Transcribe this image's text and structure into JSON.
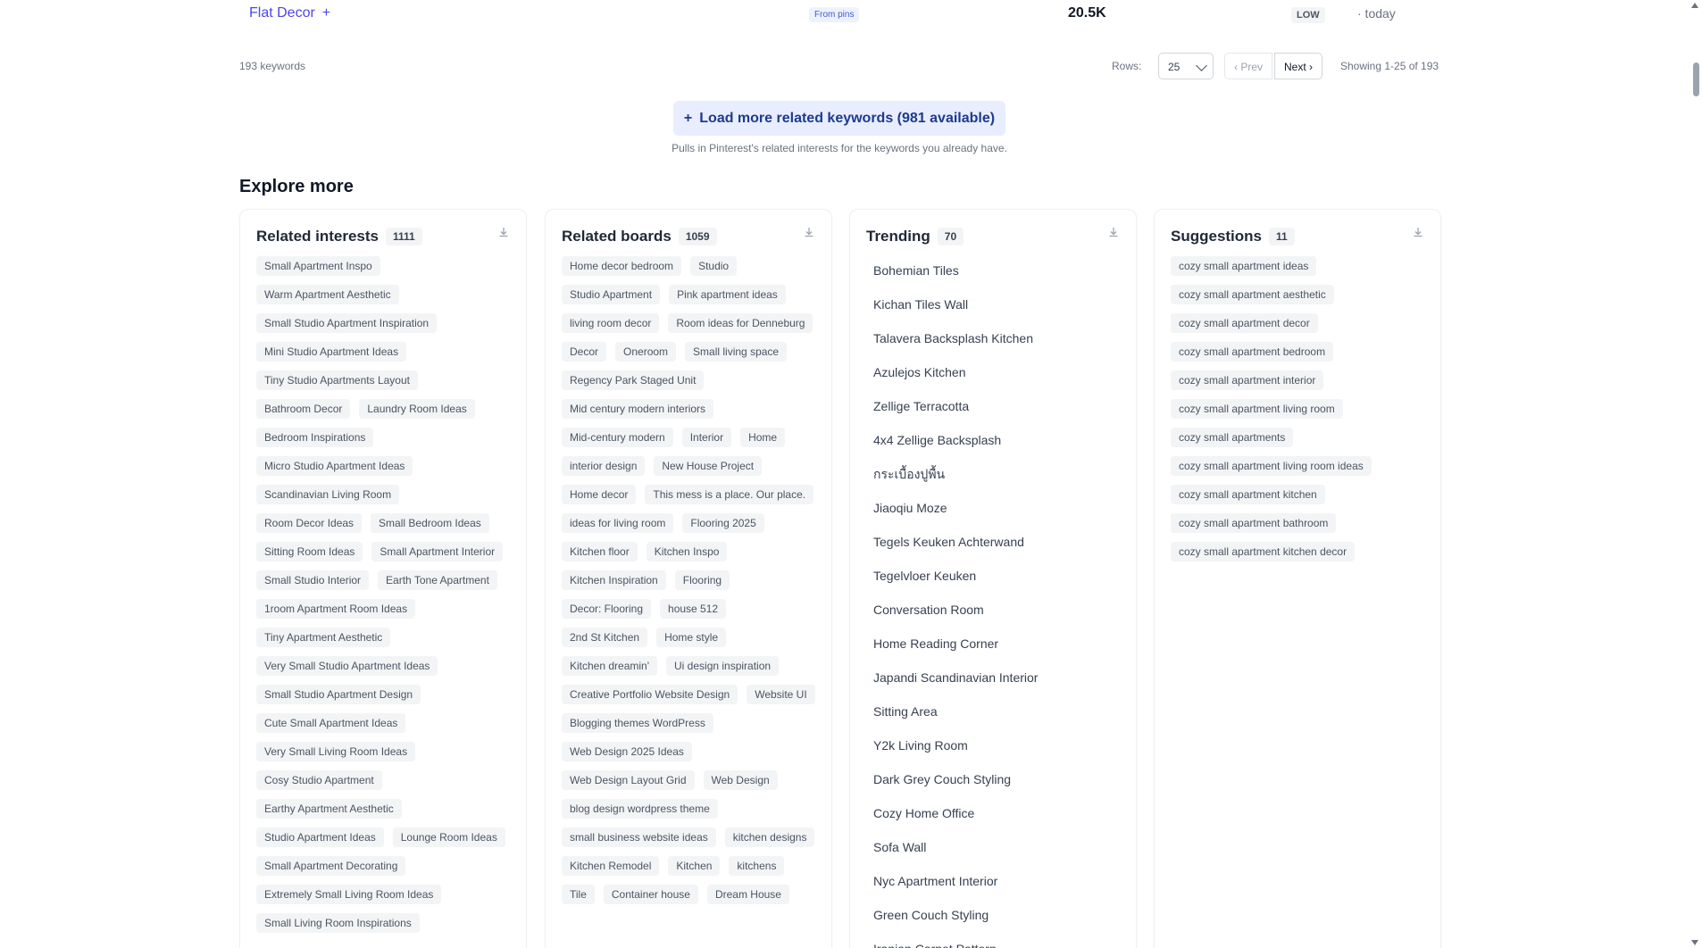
{
  "keyword_row": {
    "name": "Flat Decor",
    "add_label": "+",
    "source_badge": "From pins",
    "volume": "20.5K",
    "competition": "LOW",
    "date": "· today"
  },
  "pagination": {
    "count": "193 keywords",
    "rows_label": "Rows:",
    "rows_value": "25",
    "prev": "‹ Prev",
    "next": "Next ›",
    "showing": "Showing 1-25 of 193"
  },
  "load_more": {
    "label": "Load more related keywords (981 available)",
    "icon": "plus-icon",
    "note": "Pulls in Pinterest's related interests for the keywords you already have."
  },
  "explore": {
    "title": "Explore more",
    "related_interests": {
      "title": "Related interests",
      "count": "1111",
      "items": [
        "Small Apartment Inspo",
        "Warm Apartment Aesthetic",
        "Small Studio Apartment Inspiration",
        "Mini Studio Apartment Ideas",
        "Tiny Studio Apartments Layout",
        "Bathroom Decor",
        "Laundry Room Ideas",
        "Bedroom Inspirations",
        "Micro Studio Apartment Ideas",
        "Scandinavian Living Room",
        "Room Decor Ideas",
        "Small Bedroom Ideas",
        "Sitting Room Ideas",
        "Small Apartment Interior",
        "Small Studio Interior",
        "Earth Tone Apartment",
        "1room Apartment Room Ideas",
        "Tiny Apartment Aesthetic",
        "Very Small Studio Apartment Ideas",
        "Small Studio Apartment Design",
        "Cute Small Apartment Ideas",
        "Very Small Living Room Ideas",
        "Cosy Studio Apartment",
        "Earthy Apartment Aesthetic",
        "Studio Apartment Ideas",
        "Lounge Room Ideas",
        "Small Apartment Decorating",
        "Extremely Small Living Room Ideas",
        "Small Living Room Inspirations"
      ]
    },
    "related_boards": {
      "title": "Related boards",
      "count": "1059",
      "items": [
        "Home decor bedroom",
        "Studio",
        "Studio Apartment",
        "Pink apartment ideas",
        "living room decor",
        "Room ideas for Denneburg",
        "Decor",
        "Oneroom",
        "Small living space",
        "Regency Park Staged Unit",
        "Mid century modern interiors",
        "Mid-century modern",
        "Interior",
        "Home",
        "interior design",
        "New House Project",
        "Home decor",
        "This mess is a place. Our place.",
        "ideas for living room",
        "Flooring 2025",
        "Kitchen floor",
        "Kitchen Inspo",
        "Kitchen Inspiration",
        "Flooring",
        "Decor: Flooring",
        "house 512",
        "2nd St Kitchen",
        "Home style",
        "Kitchen dreamin'",
        "Ui design inspiration",
        "Creative Portfolio Website Design",
        "Website UI",
        "Blogging themes WordPress",
        "Web Design 2025 Ideas",
        "Web Design Layout Grid",
        "Web Design",
        "blog design wordpress theme",
        "small business website ideas",
        "kitchen designs",
        "Kitchen Remodel",
        "Kitchen",
        "kitchens",
        "Tile",
        "Container house",
        "Dream House"
      ]
    },
    "trending": {
      "title": "Trending",
      "count": "70",
      "items": [
        "Bohemian Tiles",
        "Kichan Tiles Wall",
        "Talavera Backsplash Kitchen",
        "Azulejos Kitchen",
        "Zellige Terracotta",
        "4x4 Zellige Backsplash",
        "กระเบื้องปูพื้น",
        "Jiaoqiu Moze",
        "Tegels Keuken Achterwand",
        "Tegelvloer Keuken",
        "Conversation Room",
        "Home Reading Corner",
        "Japandi Scandinavian Interior",
        "Sitting Area",
        "Y2k Living Room",
        "Dark Grey Couch Styling",
        "Cozy Home Office",
        "Sofa Wall",
        "Nyc Apartment Interior",
        "Green Couch Styling",
        "Iranian Carpet Pattern"
      ]
    },
    "suggestions": {
      "title": "Suggestions",
      "count": "11",
      "items": [
        "cozy small apartment ideas",
        "cozy small apartment aesthetic",
        "cozy small apartment decor",
        "cozy small apartment bedroom",
        "cozy small apartment interior",
        "cozy small apartment living room",
        "cozy small apartments",
        "cozy small apartment living room ideas",
        "cozy small apartment kitchen",
        "cozy small apartment bathroom",
        "cozy small apartment kitchen decor"
      ]
    },
    "download_icon": "download-icon"
  },
  "colors": {
    "accent": "#4f46e5",
    "load_more_bg": "#e8eeff",
    "tag_bg": "#f3f4f6"
  }
}
